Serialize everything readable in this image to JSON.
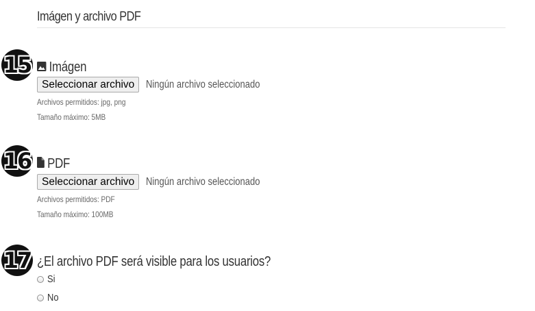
{
  "section": {
    "title": "Imágen y archivo PDF"
  },
  "image_field": {
    "step": "15",
    "icon": "image-icon",
    "label": "Imágen",
    "button_label": "Seleccionar archivo",
    "status": "Ningún archivo seleccionado",
    "allowed": "Archivos permitidos: jpg, png",
    "max_size": "Tamaño máximo: 5MB"
  },
  "pdf_field": {
    "step": "16",
    "icon": "file-icon",
    "label": "PDF",
    "button_label": "Seleccionar archivo",
    "status": "Ningún archivo seleccionado",
    "allowed": "Archivos permitidos: PDF",
    "max_size": "Tamaño máximo: 100MB"
  },
  "visibility_question": {
    "step": "17",
    "label": "¿El archivo PDF será visible para los usuarios?",
    "options": [
      {
        "label": "Si",
        "selected": false
      },
      {
        "label": "No",
        "selected": false
      }
    ]
  }
}
